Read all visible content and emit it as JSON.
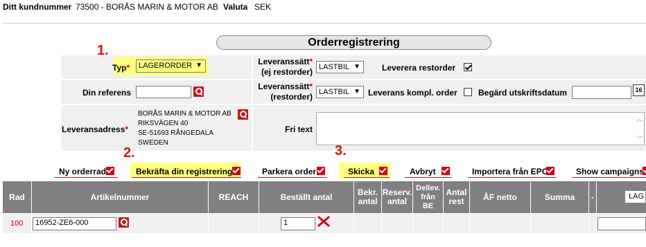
{
  "customer": {
    "label": "Ditt kundnummer",
    "value": "73500 -  BORÅS MARIN & MOTOR AB",
    "currency_label": "Valuta",
    "currency": "SEK"
  },
  "title": "Orderregistrering",
  "annotations": {
    "step1": "1.",
    "step2": "2.",
    "step3": "3."
  },
  "form": {
    "typ_label": "Typ",
    "typ_value": "LAGERORDER",
    "ref_label": "Din referens",
    "ref_value": "",
    "addr_label": "Leveransadress",
    "addr_lines": [
      "BORÅS MARIN & MOTOR AB",
      "RIKSVÄGEN 40",
      "SE-51693 RÅNGEDALA",
      "SWEDEN"
    ],
    "lev1_label1": "Leveranssätt",
    "lev1_label2": "(ej restorder)",
    "lev1_value": "LASTBIL",
    "lev2_label1": "Leveranssätt",
    "lev2_label2": "(restorder)",
    "lev2_value": "LASTBIL",
    "restorder_label": "Leverera restorder",
    "komp_label": "Leverans kompl. order",
    "utskrift_label": "Begärd utskriftsdatum",
    "utskrift_value": "",
    "cal_label": "16",
    "fritext_label": "Fri text",
    "required": "*"
  },
  "actions": [
    "Ny orderrad",
    "Bekräfta din registrering",
    "Parkera order",
    "Skicka",
    "Avbryt",
    "Importera från EPC",
    "Show campaigns"
  ],
  "table": {
    "headers": {
      "rad": "Rad",
      "art": "Artikelnummer",
      "reach": "REACH",
      "antal": "Beställt antal",
      "bekr1": "Bekr.",
      "bekr2": "antal",
      "reserv1": "Reserv.",
      "reserv2": "antal",
      "dellev1": "Dellev.",
      "dellev2": "från",
      "dellev3": "BE",
      "rest1": "Antal",
      "rest2": "rest",
      "af": "ÅF netto",
      "summa": "Summa",
      "dash": "-",
      "lag": "LAG"
    },
    "row": {
      "rad": "100",
      "art": "16952-ZE6-000",
      "antal": "1"
    }
  }
}
